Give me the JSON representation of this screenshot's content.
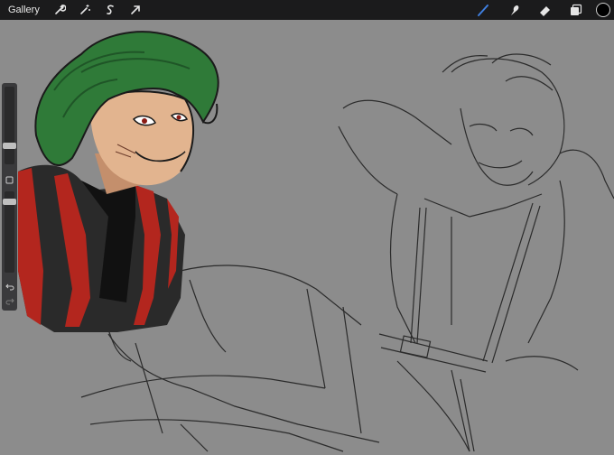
{
  "topbar": {
    "gallery_label": "Gallery",
    "tools_left": [
      {
        "icon": "wrench-icon"
      },
      {
        "icon": "magic-wand-icon"
      },
      {
        "icon": "selection-s-icon"
      },
      {
        "icon": "arrow-transform-icon"
      }
    ],
    "tools_right": [
      {
        "icon": "brush-icon",
        "active_color": "#3f7fe0"
      },
      {
        "icon": "smudge-icon"
      },
      {
        "icon": "eraser-icon"
      },
      {
        "icon": "layers-icon"
      }
    ],
    "current_color": "#000000"
  },
  "canvas": {
    "background": "#8c8c8c",
    "hair_color": "#2f7a38",
    "shirt_red": "#b3261e",
    "shirt_dark": "#2a2a2a",
    "skin_color": "#e2b48f"
  }
}
